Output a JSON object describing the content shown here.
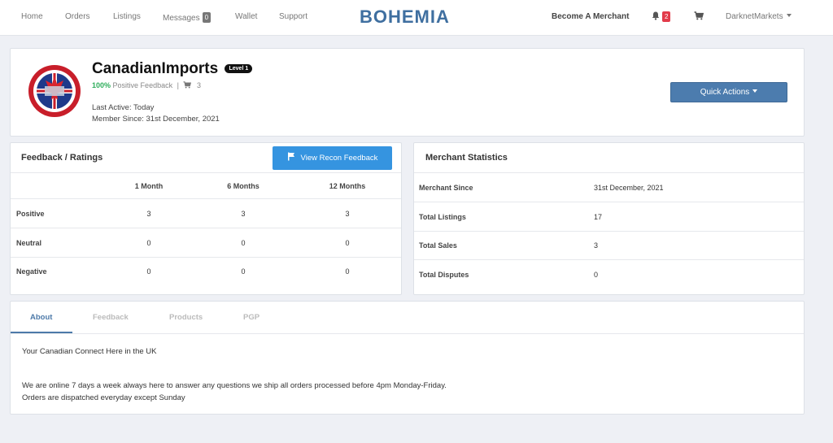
{
  "nav": {
    "home": "Home",
    "orders": "Orders",
    "listings": "Listings",
    "messages": "Messages",
    "messages_count": "0",
    "wallet": "Wallet",
    "support": "Support",
    "logo": "BOHEMIA",
    "become_merchant": "Become A Merchant",
    "notifications_count": "2",
    "user": "DarknetMarkets"
  },
  "profile": {
    "name": "CanadianImports",
    "level": "Level 1",
    "feedback_pct": "100%",
    "feedback_label": "Positive Feedback",
    "separator": "|",
    "sales_count": "3",
    "last_active": "Last Active: Today",
    "member_since": "Member Since: 31st December, 2021",
    "quick_actions": "Quick Actions"
  },
  "feedback": {
    "title": "Feedback / Ratings",
    "recon_button": "View Recon Feedback",
    "columns": [
      "1 Month",
      "6 Months",
      "12 Months"
    ],
    "rows": [
      {
        "label": "Positive",
        "values": [
          "3",
          "3",
          "3"
        ]
      },
      {
        "label": "Neutral",
        "values": [
          "0",
          "0",
          "0"
        ]
      },
      {
        "label": "Negative",
        "values": [
          "0",
          "0",
          "0"
        ]
      }
    ]
  },
  "stats": {
    "title": "Merchant Statistics",
    "rows": [
      {
        "label": "Merchant Since",
        "value": "31st December, 2021"
      },
      {
        "label": "Total Listings",
        "value": "17"
      },
      {
        "label": "Total Sales",
        "value": "3"
      },
      {
        "label": "Total Disputes",
        "value": "0"
      }
    ]
  },
  "tabs": [
    "About",
    "Feedback",
    "Products",
    "PGP"
  ],
  "about": {
    "line1": "Your Canadian Connect Here in the UK",
    "line2": "We are online 7 days a week always here to answer any questions we ship all orders processed before 4pm Monday-Friday.",
    "line3": "Orders are dispatched everyday except Sunday"
  },
  "colors": {
    "brand": "#3f6fa0",
    "quick_actions_bg": "#4c7cae",
    "recon_button_bg": "#3594e0",
    "positive_green": "#2fae5c",
    "notification_red": "#e23b4a"
  }
}
